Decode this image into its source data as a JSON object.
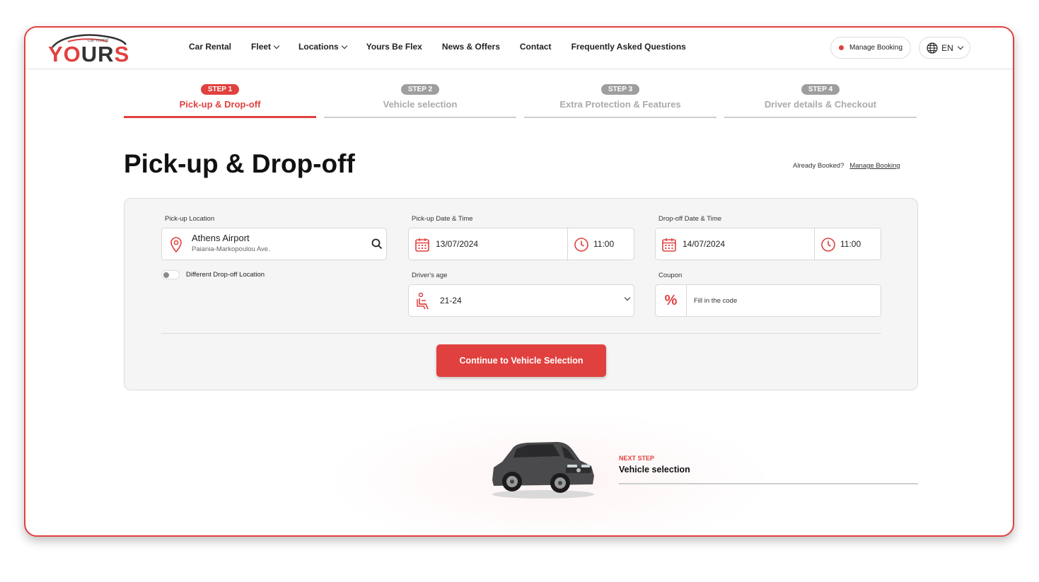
{
  "brand": {
    "name_red": "YO",
    "name_dark": "UR",
    "name_red2": "S",
    "tagline": "car rental",
    "accent": "#e0413f"
  },
  "nav": [
    {
      "label": "Car Rental",
      "dropdown": false
    },
    {
      "label": "Fleet",
      "dropdown": true
    },
    {
      "label": "Locations",
      "dropdown": true
    },
    {
      "label": "Yours Be Flex",
      "dropdown": false
    },
    {
      "label": "News & Offers",
      "dropdown": false
    },
    {
      "label": "Contact",
      "dropdown": false
    },
    {
      "label": "Frequently Asked Questions",
      "dropdown": false
    }
  ],
  "header": {
    "manage_booking": "Manage Booking",
    "language": "EN"
  },
  "steps": [
    {
      "badge": "STEP 1",
      "label": "Pick-up & Drop-off",
      "active": true
    },
    {
      "badge": "STEP 2",
      "label": "Vehicle selection",
      "active": false
    },
    {
      "badge": "STEP 3",
      "label": "Extra Protection & Features",
      "active": false
    },
    {
      "badge": "STEP 4",
      "label": "Driver details & Checkout",
      "active": false
    }
  ],
  "page": {
    "title": "Pick-up & Drop-off",
    "already_booked": "Already Booked?",
    "manage_link": "Manage Booking"
  },
  "form": {
    "pickup_location_label": "Pick-up Location",
    "pickup_location_name": "Athens Airport",
    "pickup_location_address": "Paiania-Markopoulou Ave.",
    "different_dropoff_label": "Different Drop-off Location",
    "pickup_datetime_label": "Pick-up Date & Time",
    "pickup_date": "13/07/2024",
    "pickup_time": "11:00",
    "dropoff_datetime_label": "Drop-off Date & Time",
    "dropoff_date": "14/07/2024",
    "dropoff_time": "11:00",
    "drivers_age_label": "Driver's age",
    "drivers_age_value": "21-24",
    "coupon_label": "Coupon",
    "coupon_placeholder": "Fill in the code",
    "cta": "Continue to Vehicle Selection"
  },
  "next_step": {
    "kicker": "NEXT STEP",
    "title": "Vehicle selection"
  }
}
